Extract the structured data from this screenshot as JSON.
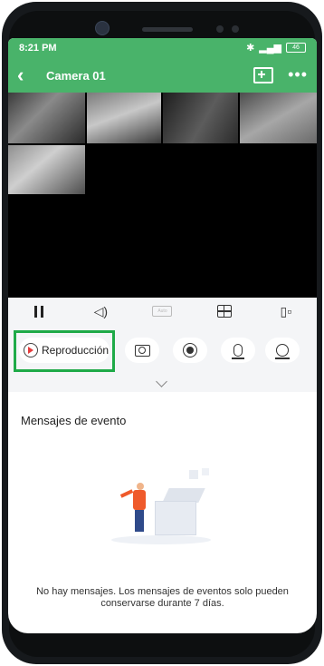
{
  "status_bar": {
    "time": "8:21 PM",
    "battery": "46"
  },
  "app_bar": {
    "title": "Camera 01"
  },
  "toolbar": {
    "hd_label": "Auto"
  },
  "controls": {
    "playback_label": "Reproducción"
  },
  "events": {
    "title": "Mensajes de evento",
    "empty_message": "No hay mensajes. Los mensajes de eventos solo pueden conservarse durante 7 días."
  },
  "colors": {
    "accent": "#49b36a",
    "highlight": "#1faa48"
  }
}
